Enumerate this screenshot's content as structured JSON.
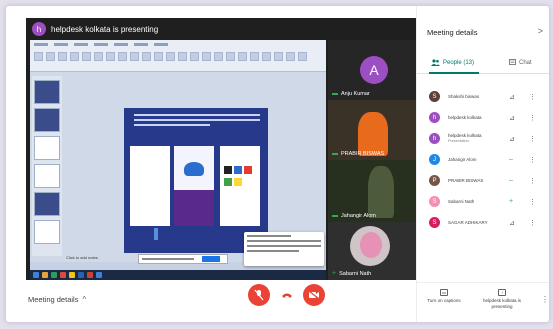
{
  "presenter": {
    "avatar_letter": "h",
    "text": "helpdesk kolkata is presenting"
  },
  "screen": {
    "click_to_add_notes": "Click to add notes"
  },
  "tiles": [
    {
      "name": "Anju Kumar",
      "avatar_letter": "A",
      "kind": "avatar"
    },
    {
      "name": "PRABIR BISWAS",
      "kind": "video"
    },
    {
      "name": "Jahangir Alom",
      "kind": "video"
    },
    {
      "name": "Sabarni Nath",
      "kind": "video"
    }
  ],
  "bottom": {
    "meeting_details": "Meeting details"
  },
  "panel": {
    "title": "Meeting details",
    "tab_people": "People (13)",
    "tab_chat": "Chat",
    "participants": [
      {
        "name": "Shakshi biswas",
        "sub": "",
        "color": "#5d4037",
        "letter": "S",
        "icon": "mic-off"
      },
      {
        "name": "helpdesk kolkata",
        "sub": "",
        "color": "#9c4fc2",
        "letter": "h",
        "icon": "mic-off"
      },
      {
        "name": "helpdesk kolkata",
        "sub": "Presentation",
        "color": "#9c4fc2",
        "letter": "h",
        "icon": "mic-off"
      },
      {
        "name": "Jahangir Alom",
        "sub": "",
        "color": "#1e88e5",
        "letter": "J",
        "icon": "mic-on"
      },
      {
        "name": "PRABIR BISWAS",
        "sub": "",
        "color": "#795548",
        "letter": "P",
        "icon": "mic-on"
      },
      {
        "name": "Sabarni Nath",
        "sub": "",
        "color": "#f48fb1",
        "letter": "S",
        "icon": "pin"
      },
      {
        "name": "SAGAR ADHIKARY",
        "sub": "",
        "color": "#d81b60",
        "letter": "S",
        "icon": "mic-off"
      }
    ],
    "footer": {
      "captions": "Turn on captions",
      "presenting": "helpdesk kolkata is presenting"
    }
  },
  "colors": {
    "accent": "#00796b",
    "danger": "#ea4335",
    "avatar_purple": "#9c4fc2"
  }
}
